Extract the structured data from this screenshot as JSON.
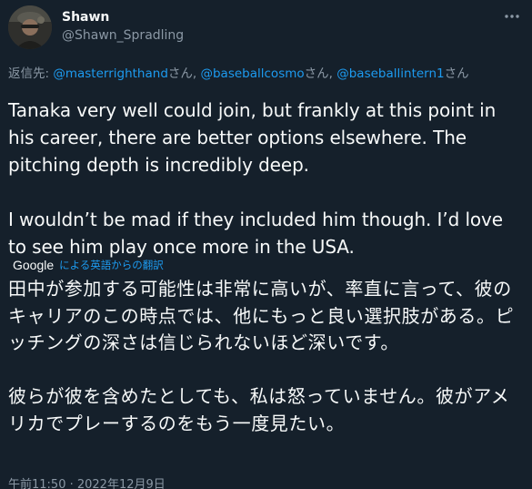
{
  "author": {
    "display_name": "Shawn",
    "handle": "@Shawn_Spradling",
    "avatar_icon": "user-avatar"
  },
  "menu_icon": "more-horizontal-icon",
  "reply": {
    "prefix": "返信先: ",
    "mentions": [
      {
        "handle": "@masterrighthand",
        "suffix": "さん, "
      },
      {
        "handle": "@baseballcosmo",
        "suffix": "さん, "
      },
      {
        "handle": "@baseballintern1",
        "suffix": "さん"
      }
    ]
  },
  "tweet_text": "Tanaka very well could join, but frankly at this point in his career, there are better options elsewhere. The pitching depth is incredibly deep.\n\nI wouldn’t be mad if they included him though. I’d love to see him play once more in the USA.",
  "translation": {
    "provider": "Google",
    "label": "による英語からの翻訳",
    "text": "田中が参加する可能性は非常に高いが、率直に言って、彼のキャリアのこの時点では、他にもっと良い選択肢がある。ピッチングの深さは信じられないほど深いです。\n\n彼らが彼を含めたとしても、私は怒っていません。彼がアメリカでプレーするのをもう一度見たい。"
  },
  "timestamp": "午前11:50 · 2022年12月9日",
  "colors": {
    "background": "#15202b",
    "text_primary": "#f7f9f9",
    "text_secondary": "#8b98a5",
    "link": "#1d9bf0"
  }
}
